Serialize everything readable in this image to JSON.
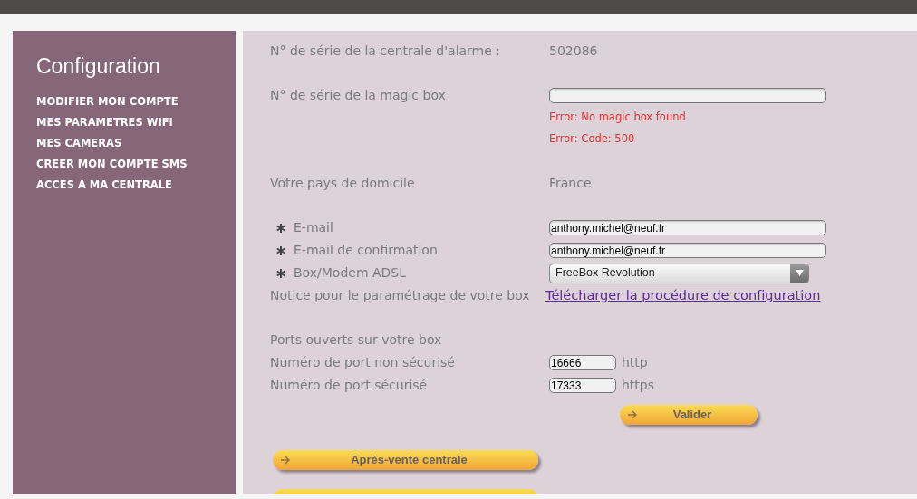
{
  "sidebar": {
    "title": "Configuration",
    "items": [
      "MODIFIER MON COMPTE",
      "MES PARAMETRES WIFI",
      "MES CAMERAS",
      "CREER MON COMPTE SMS",
      "ACCES A MA CENTRALE"
    ]
  },
  "form": {
    "sections": [
      [
        {
          "kind": "static",
          "label": "N° de série de la centrale d'alarme :",
          "value": "502086"
        }
      ],
      [
        {
          "kind": "input",
          "label": "N° de série de la magic box",
          "errors": [
            "Error: No magic box found",
            "Error: Code: 500"
          ]
        }
      ],
      [
        {
          "kind": "static",
          "label": "Votre pays de domicile",
          "value": "France"
        }
      ],
      [
        {
          "kind": "input",
          "label": "E-mail",
          "value": "anthony.michel@neuf.fr",
          "required": true
        },
        {
          "kind": "input",
          "label": "E-mail de confirmation",
          "value": "anthony.michel@neuf.fr",
          "required": true
        },
        {
          "kind": "select",
          "label": "Box/Modem ADSL",
          "value": "FreeBox Revolution",
          "required": true
        },
        {
          "kind": "link",
          "label": "Notice pour le paramétrage de votre box",
          "value": "Télécharger la procédure de configuration"
        }
      ],
      [
        {
          "kind": "heading",
          "label": "Ports ouverts sur votre box"
        },
        {
          "kind": "port",
          "label": "Numéro de port non sécurisé",
          "value": "16666",
          "unit": "http"
        },
        {
          "kind": "port",
          "label": "Numéro de port sécurisé",
          "value": "17333",
          "unit": "https"
        }
      ]
    ],
    "submit": "Valider"
  },
  "actions": [
    "Après-vente centrale"
  ]
}
